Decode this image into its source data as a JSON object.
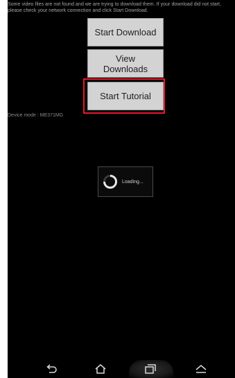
{
  "notice": {
    "text": "Some video files are not found and we are trying to download them. If your download did not start, please check your network connection and click Start Download."
  },
  "buttons": {
    "start_download": "Start Download",
    "view_downloads": "View\nDownloads",
    "start_tutorial": "Start Tutorial"
  },
  "device_mode": "Device mode : ME371MG",
  "loading": {
    "text": "Loading..."
  },
  "icons": {
    "back": "back-icon",
    "home": "home-icon",
    "recent_apps": "recent-apps-icon",
    "menu": "menu-icon",
    "spinner": "spinner-icon"
  },
  "colors": {
    "highlight": "#e8192c",
    "button_bg": "#d3d3d3",
    "screen_bg": "#000000"
  }
}
